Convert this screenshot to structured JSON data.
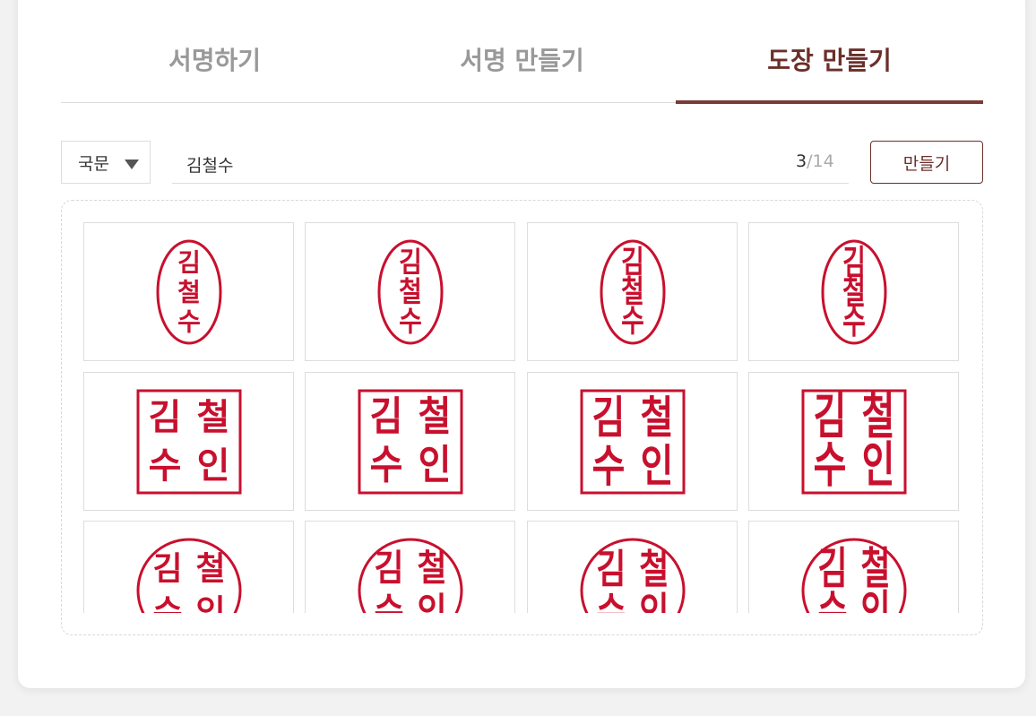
{
  "tabs": [
    {
      "label": "서명하기",
      "active": false
    },
    {
      "label": "서명 만들기",
      "active": false
    },
    {
      "label": "도장 만들기",
      "active": true
    }
  ],
  "controls": {
    "script_select": "국문",
    "name_value": "김철수",
    "counter_current": "3",
    "counter_max": "/14",
    "make_button": "만들기"
  },
  "seal_color": "#c8102e",
  "seals": [
    {
      "shape": "oval",
      "style": 1,
      "chars": [
        "김",
        "철",
        "수"
      ]
    },
    {
      "shape": "oval",
      "style": 2,
      "chars": [
        "김",
        "철",
        "수"
      ]
    },
    {
      "shape": "oval",
      "style": 3,
      "chars": [
        "김",
        "철",
        "수"
      ]
    },
    {
      "shape": "oval",
      "style": 4,
      "chars": [
        "김",
        "철",
        "수"
      ]
    },
    {
      "shape": "square",
      "style": 1,
      "chars": [
        "김",
        "철",
        "수",
        "인"
      ]
    },
    {
      "shape": "square",
      "style": 2,
      "chars": [
        "김",
        "철",
        "수",
        "인"
      ]
    },
    {
      "shape": "square",
      "style": 3,
      "chars": [
        "김",
        "철",
        "수",
        "인"
      ]
    },
    {
      "shape": "square",
      "style": 4,
      "chars": [
        "김",
        "철",
        "수",
        "인"
      ]
    },
    {
      "shape": "circle",
      "style": 1,
      "chars": [
        "김",
        "철",
        "수",
        "인"
      ]
    },
    {
      "shape": "circle",
      "style": 2,
      "chars": [
        "김",
        "철",
        "수",
        "인"
      ]
    },
    {
      "shape": "circle",
      "style": 3,
      "chars": [
        "김",
        "철",
        "수",
        "인"
      ]
    },
    {
      "shape": "circle",
      "style": 4,
      "chars": [
        "김",
        "철",
        "수",
        "인"
      ]
    }
  ]
}
